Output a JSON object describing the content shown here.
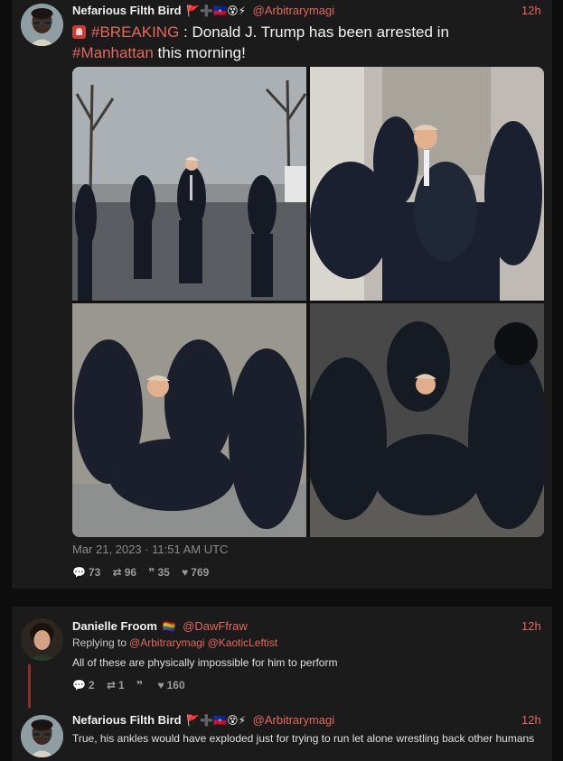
{
  "tweet": {
    "author_name": "Nefarious Filth Bird",
    "author_flags": "🚩➕🇭🇹😵⚡",
    "handle": "@Arbitrarymagi",
    "time": "12h",
    "headline_tag": "#BREAKING",
    "headline_mid": " : Donald J. Trump has been arrested in",
    "headline_place": "#Manhattan",
    "headline_end": " this morning!",
    "date": "Mar 21, 2023 · 11:51 AM UTC",
    "stats": {
      "comments": "73",
      "retweets": "96",
      "quotes": "35",
      "likes": "769"
    },
    "icons": [
      "comment-icon",
      "retweet-icon",
      "quote-icon",
      "heart-icon"
    ]
  },
  "reply1": {
    "author_name": "Danielle Froom",
    "author_flags": "🏳️‍🌈",
    "handle": "@DawFfraw",
    "time": "12h",
    "replying_label": "Replying to",
    "replying_handles": [
      "@Arbitrarymagi",
      "@KaoticLeftist"
    ],
    "text": "All of these are physically impossible for him to perform",
    "stats": {
      "comments": "2",
      "retweets": "1",
      "quotes": "",
      "likes": "160"
    }
  },
  "reply2": {
    "author_name": "Nefarious Filth Bird",
    "author_flags": "🚩➕🇭🇹😵⚡",
    "handle": "@Arbitrarymagi",
    "time": "12h",
    "text": "True, his ankles would have exploded just for trying to run let alone wrestling back other humans"
  },
  "colors": {
    "accent": "#e4685d",
    "background": "#0d0d0d",
    "card": "#1b1b1b",
    "thread_line": "#8a2f29"
  }
}
